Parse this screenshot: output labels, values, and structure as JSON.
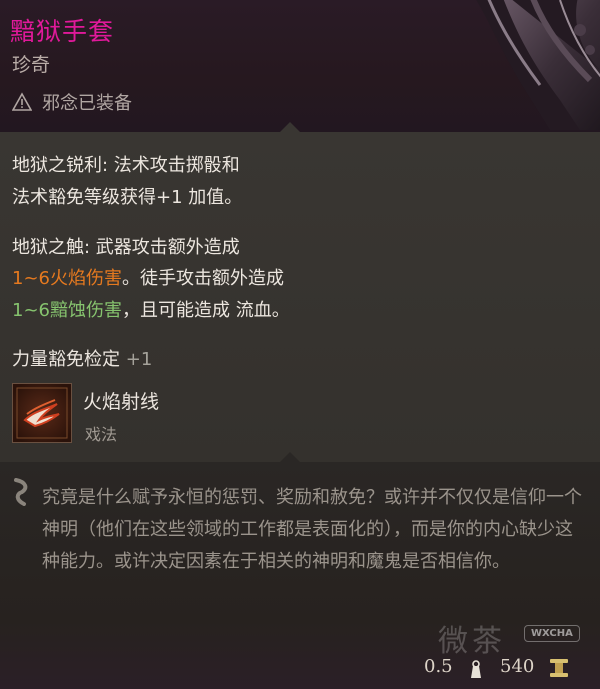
{
  "item": {
    "title": "黯狱手套",
    "rarity": "珍奇",
    "equip_status": "邪念已装备",
    "icon": "warning-icon"
  },
  "properties": {
    "p1_line1": "地狱之锐利: 法术攻击掷骰和",
    "p1_line2": "法术豁免等级获得+1 加值。",
    "p2_line1": "地狱之触: 武器攻击额外造成",
    "p2_fire": "1~6火焰伤害",
    "p2_mid": "。徒手攻击额外造成",
    "p2_necro": "1~6黯蚀伤害",
    "p2_end": "，且可能造成 流血。",
    "save_label": "力量豁免检定 ",
    "save_bonus": "+1"
  },
  "spell": {
    "name": "火焰射线",
    "type": "戏法",
    "icon": "fire-ray-icon"
  },
  "lore": {
    "text": "究竟是什么赋予永恒的惩罚、奖励和赦免？或许并不仅仅是信仰一个神明（他们在这些领域的工作都是表面化的），而是你的内心缺少这种能力。或许决定因素在于相关的神明和魔鬼是否相信你。"
  },
  "footer": {
    "weight": "0.5",
    "price": "540",
    "watermark": "微茶",
    "watermark_badge": "WXCHA"
  },
  "colors": {
    "title": "#e0199a",
    "fire": "#e5791f",
    "necrotic": "#86c36e"
  }
}
